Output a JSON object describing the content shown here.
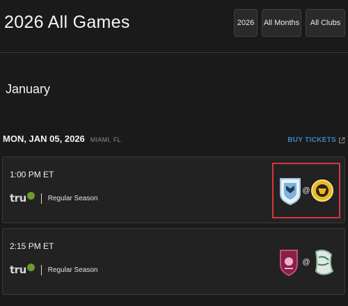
{
  "header": {
    "title": "2026 All Games",
    "filters": [
      {
        "label": "2026"
      },
      {
        "label": "All Months"
      },
      {
        "label": "All Clubs"
      }
    ]
  },
  "month": "January",
  "day": {
    "date": "MON, JAN 05, 2026",
    "location": "MIAMI, FL",
    "buy_tickets_label": "BUY TICKETS",
    "buy_tickets_icon": "external-link-icon",
    "accent_color": "#3b82c4"
  },
  "games": [
    {
      "time": "1:00 PM ET",
      "broadcaster": "tru",
      "broadcaster_icon": "tru-tv-logo",
      "game_type": "Regular Season",
      "at_sign": "@",
      "away_team_icon": "away-team-logo",
      "home_team_icon": "home-team-logo",
      "highlighted": true,
      "highlight_color": "#d8373a"
    },
    {
      "time": "2:15 PM ET",
      "broadcaster": "tru",
      "broadcaster_icon": "tru-tv-logo",
      "game_type": "Regular Season",
      "at_sign": "@",
      "away_team_icon": "away-team-logo",
      "home_team_icon": "home-team-logo",
      "highlighted": false
    }
  ]
}
